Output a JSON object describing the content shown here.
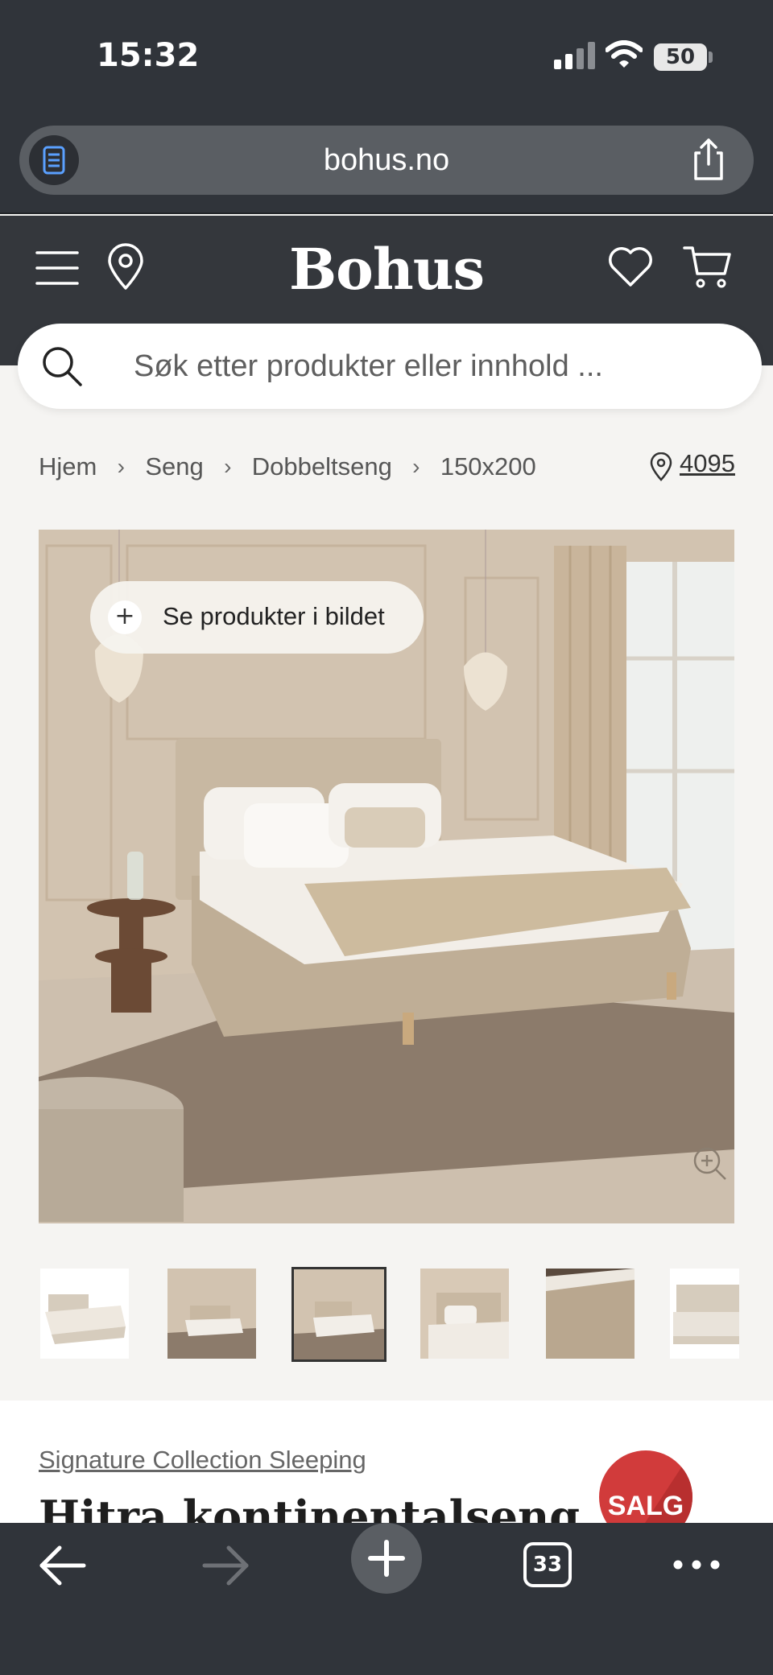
{
  "status_bar": {
    "time": "15:32",
    "battery": "50"
  },
  "browser": {
    "url": "bohus.no",
    "open_tabs": "33"
  },
  "site": {
    "logo": "Bohus"
  },
  "search": {
    "placeholder": "Søk etter produkter eller innhold ..."
  },
  "breadcrumb": {
    "items": [
      "Hjem",
      "Seng",
      "Dobbeltseng",
      "150x200"
    ],
    "separator": "›"
  },
  "store": {
    "postal_code": "4095"
  },
  "gallery": {
    "shop_the_look_label": "Se produkter i bildet",
    "thumbnail_count": 6,
    "selected_index": 2
  },
  "product": {
    "brand": "Signature Collection Sleeping",
    "title": "Hitra kontinentalseng",
    "badge": "SALG"
  },
  "colors": {
    "header_bg": "#34373c",
    "sale_red": "#d13b3b",
    "page_bg": "#f5f4f2"
  }
}
